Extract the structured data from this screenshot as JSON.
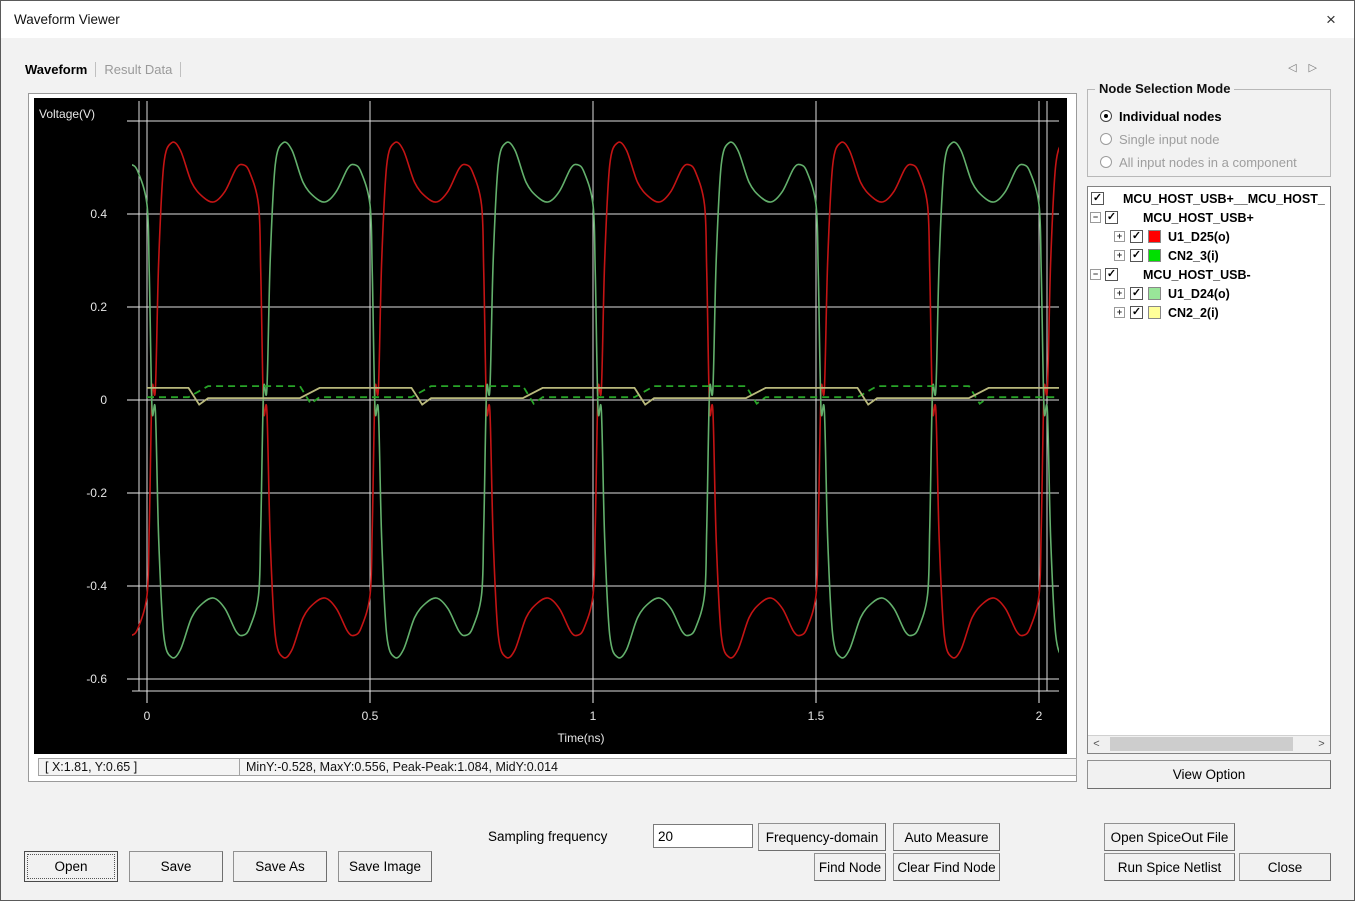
{
  "window": {
    "title": "Waveform Viewer",
    "close_glyph": "×"
  },
  "tabs": {
    "waveform": "Waveform",
    "result_data": "Result Data",
    "left_arrow": "◁",
    "right_arrow": "▷"
  },
  "status": {
    "cursor": "[ X:1.81, Y:0.65 ]",
    "measure": "MinY:-0.528, MaxY:0.556, Peak-Peak:1.084, MidY:0.014"
  },
  "node_selection": {
    "title": "Node Selection Mode",
    "options": [
      {
        "label": "Individual nodes",
        "selected": true,
        "enabled": true
      },
      {
        "label": "Single input node",
        "selected": false,
        "enabled": false
      },
      {
        "label": "All input nodes in a component",
        "selected": false,
        "enabled": false
      }
    ]
  },
  "tree": {
    "items": [
      {
        "label": "MCU_HOST_USB+__MCU_HOST_",
        "level": 0,
        "expander": null,
        "swatch": null,
        "checked": true
      },
      {
        "label": "MCU_HOST_USB+",
        "level": 1,
        "expander": "minus",
        "swatch": null,
        "checked": true
      },
      {
        "label": "U1_D25(o)",
        "level": 2,
        "expander": "plus",
        "swatch": "#ff0000",
        "checked": true
      },
      {
        "label": "CN2_3(i)",
        "level": 2,
        "expander": "plus",
        "swatch": "#00e000",
        "checked": true
      },
      {
        "label": "MCU_HOST_USB-",
        "level": 1,
        "expander": "minus",
        "swatch": null,
        "checked": true
      },
      {
        "label": "U1_D24(o)",
        "level": 2,
        "expander": "plus",
        "swatch": "#99e699",
        "checked": true
      },
      {
        "label": "CN2_2(i)",
        "level": 2,
        "expander": "plus",
        "swatch": "#ffff99",
        "checked": true
      }
    ],
    "scroll_left": "<",
    "scroll_right": ">"
  },
  "buttons": {
    "open": "Open",
    "save": "Save",
    "save_as": "Save As",
    "save_image": "Save Image",
    "frequency_domain": "Frequency-domain",
    "auto_measure": "Auto Measure",
    "find_node": "Find Node",
    "clear_find_node": "Clear Find Node",
    "view_option": "View Option",
    "open_spiceout": "Open SpiceOut File",
    "run_spice": "Run Spice Netlist",
    "close": "Close"
  },
  "sampling": {
    "label": "Sampling frequency",
    "value": "20"
  },
  "chart_data": {
    "type": "line",
    "title": "",
    "xlabel": "Time(ns)",
    "ylabel": "Voltage(V)",
    "x_range": [
      0,
      2.05
    ],
    "y_range": [
      -0.68,
      0.66
    ],
    "x_ticks": [
      0,
      0.5,
      1,
      1.5,
      2
    ],
    "x_tick_labels": [
      "0",
      "0.5",
      "1",
      "1.5",
      "2"
    ],
    "y_grid": [
      0.6,
      0.4,
      0.2,
      0,
      -0.2,
      -0.4,
      -0.6
    ],
    "y_tick_labels": [
      null,
      "0.4",
      "0.2",
      "0",
      "-0.2",
      "-0.4",
      "-0.6"
    ],
    "grid_on": true,
    "grid_color": "#dedede",
    "bg": "#000000",
    "legend_position": "none",
    "period_ns": 0.5,
    "half_cycle_anchors": [
      [
        0.0,
        -0.42
      ],
      [
        0.02,
        -0.28
      ],
      [
        0.045,
        0.018
      ],
      [
        0.075,
        0.024
      ],
      [
        0.105,
        0.3
      ],
      [
        0.15,
        0.505
      ],
      [
        0.22,
        0.553
      ],
      [
        0.3,
        0.537
      ],
      [
        0.4,
        0.468
      ],
      [
        0.5,
        0.437
      ],
      [
        0.6,
        0.426
      ],
      [
        0.7,
        0.449
      ],
      [
        0.8,
        0.498
      ],
      [
        0.86,
        0.506
      ],
      [
        0.92,
        0.49
      ]
    ],
    "nearzero_crossing_start": 0.115,
    "nearzero_crossing_interval": 0.25,
    "series": [
      {
        "name": "U1_D25(o)",
        "kind": "differential",
        "color": "#c41414",
        "phase_ns": 0.0,
        "width": 1.6,
        "dash": ""
      },
      {
        "name": "CN2_3(i)",
        "kind": "differential",
        "color": "#63b06c",
        "phase_ns": 0.25,
        "width": 1.6,
        "dash": ""
      },
      {
        "name": "U1_D24(o)",
        "kind": "nearzero",
        "color": "#28a428",
        "first": "rise",
        "levels": [
          0.006,
          0.03
        ],
        "width": 1.8,
        "dash": "7 5"
      },
      {
        "name": "CN2_2(i)",
        "kind": "nearzero",
        "color": "#b9b97c",
        "first": "fall",
        "levels": [
          0.004,
          0.026
        ],
        "width": 1.8,
        "dash": ""
      }
    ],
    "measurements": {
      "MinY": -0.528,
      "MaxY": 0.556,
      "Peak_Peak": 1.084,
      "MidY": 0.014
    }
  }
}
